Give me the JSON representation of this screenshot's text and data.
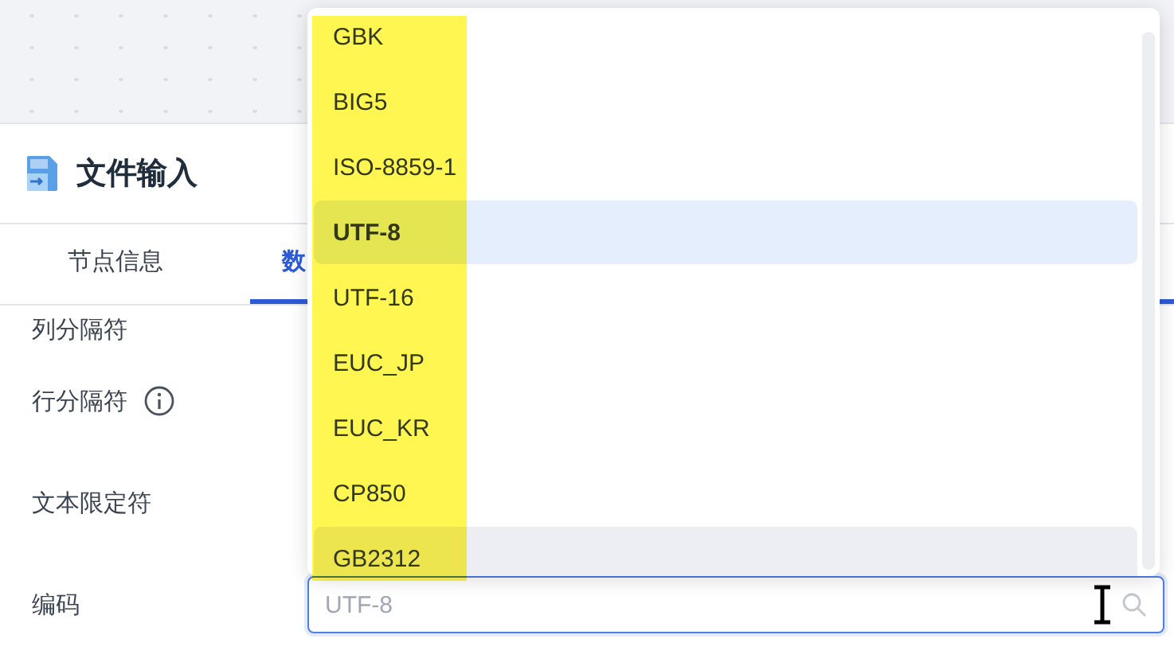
{
  "panel": {
    "title": "文件输入"
  },
  "tabs": [
    {
      "label": "节点信息",
      "selected": false
    },
    {
      "label": "数",
      "selected": true
    }
  ],
  "fields": [
    {
      "label": "列分隔符",
      "info": false
    },
    {
      "label": "行分隔符",
      "info": true
    },
    {
      "label": "文本限定符",
      "info": false
    },
    {
      "label": "编码",
      "info": false
    }
  ],
  "encoding_select": {
    "value": "UTF-8"
  },
  "dropdown": {
    "options": [
      {
        "label": "GBK",
        "selected": false,
        "hovered": false
      },
      {
        "label": "BIG5",
        "selected": false,
        "hovered": false
      },
      {
        "label": "ISO-8859-1",
        "selected": false,
        "hovered": false
      },
      {
        "label": "UTF-8",
        "selected": true,
        "hovered": false
      },
      {
        "label": "UTF-16",
        "selected": false,
        "hovered": false
      },
      {
        "label": "EUC_JP",
        "selected": false,
        "hovered": false
      },
      {
        "label": "EUC_KR",
        "selected": false,
        "hovered": false
      },
      {
        "label": "CP850",
        "selected": false,
        "hovered": false
      },
      {
        "label": "GB2312",
        "selected": false,
        "hovered": true
      }
    ]
  }
}
